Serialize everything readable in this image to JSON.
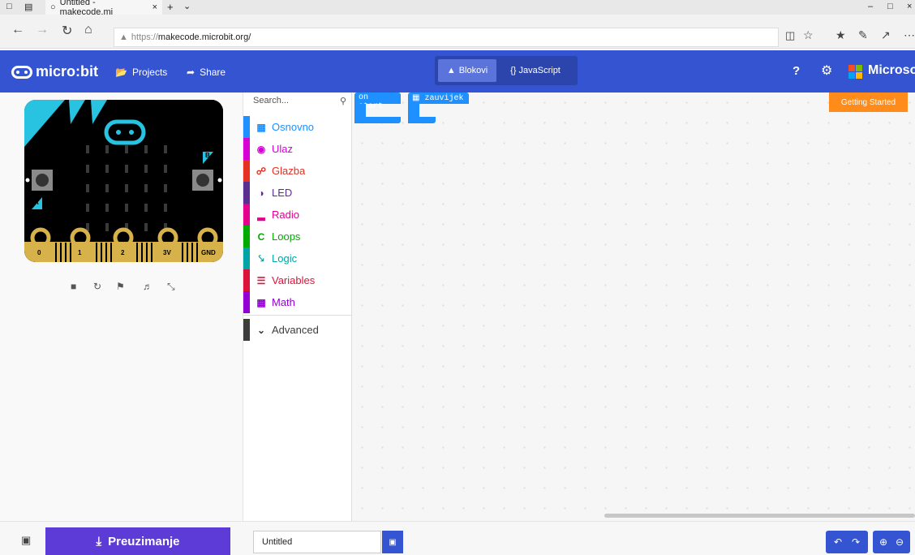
{
  "browser": {
    "tab_title": "Untitled - makecode.mi",
    "url_prefix": "https://",
    "url_host": "makecode.microbit.org/"
  },
  "menubar": {
    "logo_text": "micro:bit",
    "projects_label": "Projects",
    "share_label": "Share",
    "blocks_label": "Blokovi",
    "javascript_label": "{} JavaScript",
    "brand_label": "Microsoft",
    "accent_color": "#3454d1"
  },
  "simulator": {
    "pins": [
      "0",
      "1",
      "2",
      "3V",
      "GND"
    ],
    "button_a": "A",
    "button_b": "B"
  },
  "toolbox": {
    "search_placeholder": "Search...",
    "categories": [
      {
        "label": "Osnovno",
        "color": "#1e90ff",
        "icon": "grid-icon"
      },
      {
        "label": "Ulaz",
        "color": "#d400d4",
        "icon": "target-icon"
      },
      {
        "label": "Glazba",
        "color": "#e63022",
        "icon": "headphones-icon"
      },
      {
        "label": "LED",
        "color": "#5c2d91",
        "icon": "toggle-icon"
      },
      {
        "label": "Radio",
        "color": "#e3008c",
        "icon": "signal-icon"
      },
      {
        "label": "Loops",
        "color": "#00aa00",
        "icon": "loop-icon"
      },
      {
        "label": "Logic",
        "color": "#00a4a6",
        "icon": "shuffle-icon"
      },
      {
        "label": "Variables",
        "color": "#dc143c",
        "icon": "list-icon"
      },
      {
        "label": "Math",
        "color": "#9400d3",
        "icon": "calculator-icon"
      },
      {
        "label": "Advanced",
        "color": "#3c3c3c",
        "icon": "chevron-down-icon"
      }
    ]
  },
  "workspace": {
    "block_on_start": "on start",
    "block_forever": "zauvijek",
    "getting_started": "Getting Started"
  },
  "bottombar": {
    "download_label": "Preuzimanje",
    "project_name": "Untitled"
  }
}
